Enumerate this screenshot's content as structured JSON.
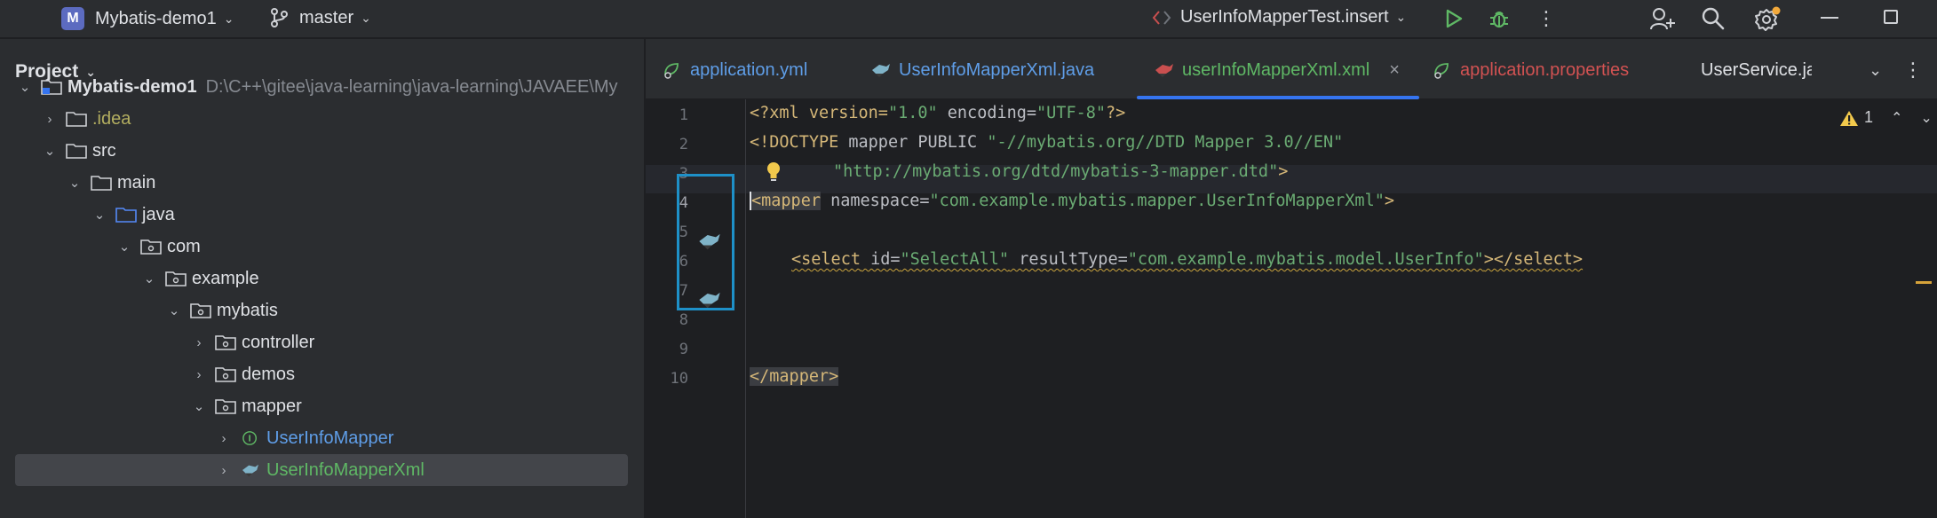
{
  "titlebar": {
    "project_badge": "M",
    "project_name": "Mybatis-demo1",
    "branch": "master",
    "run_config": "UserInfoMapperTest.insert"
  },
  "project_panel": {
    "title": "Project",
    "tree": [
      {
        "label": "Mybatis-demo1",
        "path": "D:\\C++\\gitee\\java-learning\\java-learning\\JAVAEE\\My",
        "expanded": true
      },
      {
        "label": ".idea",
        "expanded": false
      },
      {
        "label": "src",
        "expanded": true
      },
      {
        "label": "main",
        "expanded": true
      },
      {
        "label": "java",
        "expanded": true
      },
      {
        "label": "com",
        "expanded": true
      },
      {
        "label": "example",
        "expanded": true
      },
      {
        "label": "mybatis",
        "expanded": true
      },
      {
        "label": "controller",
        "expanded": false
      },
      {
        "label": "demos",
        "expanded": false
      },
      {
        "label": "mapper",
        "expanded": true
      },
      {
        "label": "UserInfoMapper",
        "expanded": false
      },
      {
        "label": "UserInfoMapperXml",
        "expanded": false,
        "selected": true
      }
    ]
  },
  "tabs": [
    {
      "label": "application.yml"
    },
    {
      "label": "UserInfoMapperXml.java"
    },
    {
      "label": "userInfoMapperXml.xml",
      "active": true
    },
    {
      "label": "application.properties"
    },
    {
      "label": "UserService.jav"
    }
  ],
  "editor": {
    "warning_count": "1",
    "line_numbers": [
      "1",
      "2",
      "3",
      "4",
      "5",
      "6",
      "7",
      "8",
      "9",
      "10"
    ],
    "lines": {
      "l1": {
        "a": "<?xml version=",
        "b": "\"1.0\"",
        "c": " encoding=",
        "d": "\"UTF-8\"",
        "e": "?>"
      },
      "l2": {
        "a": "<!DOCTYPE ",
        "b": "mapper PUBLIC ",
        "c": "\"-//mybatis.org//DTD Mapper 3.0//EN\""
      },
      "l3": {
        "a": "\"http://mybatis.org/dtd/mybatis-3-mapper.dtd\"",
        "b": ">"
      },
      "l4": {
        "a": "<mapper",
        "b": " namespace=",
        "c": "\"com.example.mybatis.mapper.UserInfoMapperXml\"",
        "d": ">"
      },
      "l6": {
        "a": "<select",
        "b": " id=",
        "c": "\"SelectAll\"",
        "d": " resultType=",
        "e": "\"com.example.mybatis.model.UserInfo\"",
        "f": "></select>"
      },
      "l10": {
        "a": "</mapper>"
      }
    }
  },
  "colors": {
    "accent": "#3574f0",
    "tag": "#d5b778",
    "string": "#6aab73",
    "highlight_box": "#1e90c8"
  }
}
